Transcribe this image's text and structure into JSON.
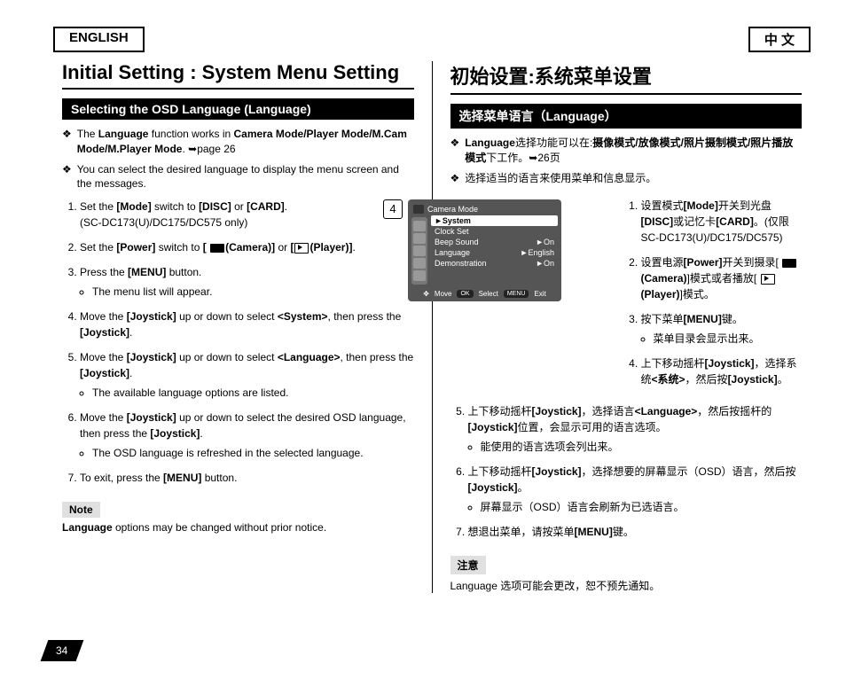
{
  "header": {
    "english": "ENGLISH",
    "chinese": "中 文"
  },
  "en": {
    "title": "Initial Setting : System Menu Setting",
    "section": "Selecting the OSD Language (Language)",
    "intro2": "You can select the desired language to display the menu screen and the messages.",
    "step3sub": "The menu list will appear.",
    "step5sub": "The available language options are listed.",
    "step6sub": "The OSD language is refreshed in the selected language.",
    "note_label": "Note"
  },
  "cn": {
    "title": "初始设置:系统菜单设置",
    "section": "选择菜单语言（Language）",
    "intro2": "选择适当的语言来使用菜单和信息显示。",
    "step3sub": "菜单目录会显示出来。",
    "step5sub": "能使用的语言选项会列出来。",
    "step6sub": "屏幕显示（OSD）语言会刷新为已选语言。",
    "note_label": "注意",
    "note": "Language 选项可能会更改，恕不预先通知。"
  },
  "osd": {
    "step": "4",
    "mode": "Camera Mode",
    "menu": [
      "►System",
      "Clock Set",
      "Beep Sound",
      "Language",
      "Demonstration"
    ],
    "vals": [
      "On",
      "English",
      "On"
    ],
    "nav": [
      "Move",
      "Select",
      "Exit"
    ]
  },
  "page": "34"
}
